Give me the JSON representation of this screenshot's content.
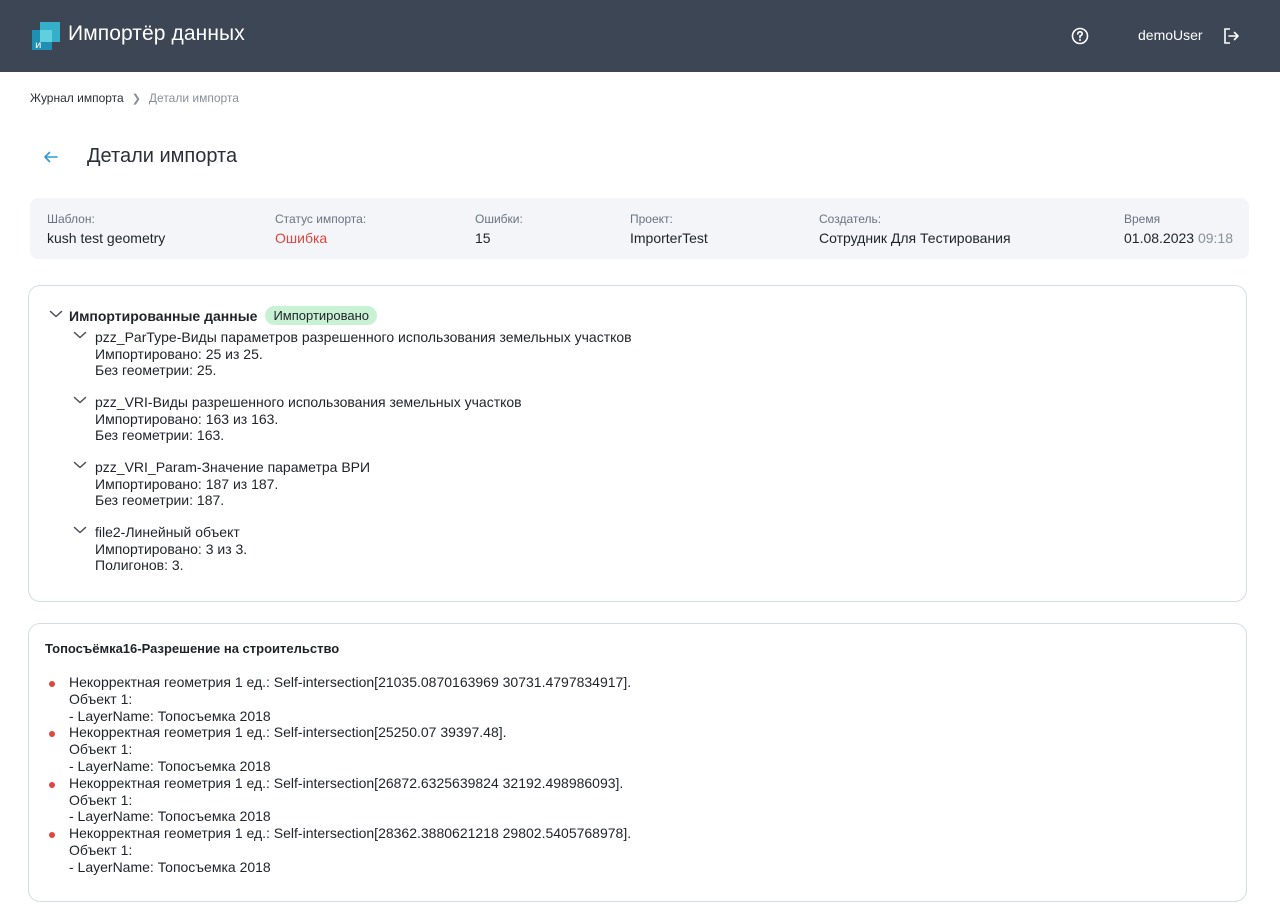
{
  "header": {
    "app_title": "Импортёр данных",
    "help_icon": "question-circle-icon",
    "username": "demoUser",
    "logout_icon": "logout-icon",
    "bar_color": "#3d4655"
  },
  "breadcrumb": {
    "parent": "Журнал импорта",
    "current": "Детали импорта"
  },
  "page": {
    "title": "Детали импорта"
  },
  "info": {
    "template_label": "Шаблон:",
    "template_value": "kush test geometry",
    "status_label": "Статус импорта:",
    "status_value": "Ошибка",
    "errors_label": "Ошибки:",
    "errors_value": "15",
    "project_label": "Проект:",
    "project_value": "ImporterTest",
    "creator_label": "Создатель:",
    "creator_value": "Сотрудник Для Тестирования",
    "time_label": "Время",
    "time_date": "01.08.2023",
    "time_clock": "09:18"
  },
  "imported": {
    "title": "Импортированные данные",
    "badge": "Импортировано",
    "groups": [
      {
        "title": "pzz_ParType-Виды параметров разрешенного использования земельных участков",
        "line1": "Импортировано: 25 из 25.",
        "line2": "Без геометрии: 25."
      },
      {
        "title": "pzz_VRI-Виды разрешенного использования земельных участков",
        "line1": "Импортировано: 163 из 163.",
        "line2": "Без геометрии: 163."
      },
      {
        "title": "pzz_VRI_Param-Значение параметра ВРИ",
        "line1": "Импортировано: 187 из 187.",
        "line2": "Без геометрии: 187."
      },
      {
        "title": "file2-Линейный объект",
        "line1": "Импортировано: 3 из 3.",
        "line2": "Полигонов: 3."
      }
    ]
  },
  "errors": {
    "title": "Топосъёмка16-Разрешение на строительство",
    "items": [
      {
        "line1": "Некорректная геометрия 1 ед.: Self-intersection[21035.0870163969 30731.4797834917].",
        "line2": "Объект 1:",
        "line3": "- LayerName: Топосъемка 2018"
      },
      {
        "line1": "Некорректная геометрия 1 ед.: Self-intersection[25250.07 39397.48].",
        "line2": "Объект 1:",
        "line3": "- LayerName: Топосъемка 2018"
      },
      {
        "line1": "Некорректная геометрия 1 ед.: Self-intersection[26872.6325639824 32192.498986093].",
        "line2": "Объект 1:",
        "line3": "- LayerName: Топосъемка 2018"
      },
      {
        "line1": "Некорректная геометрия 1 ед.: Self-intersection[28362.3880621218 29802.5405768978].",
        "line2": "Объект 1:",
        "line3": "- LayerName: Топосъемка 2018"
      }
    ]
  },
  "colors": {
    "error": "#e0453e",
    "badge_bg": "#c9f2d4",
    "accent": "#2f9bd6"
  }
}
